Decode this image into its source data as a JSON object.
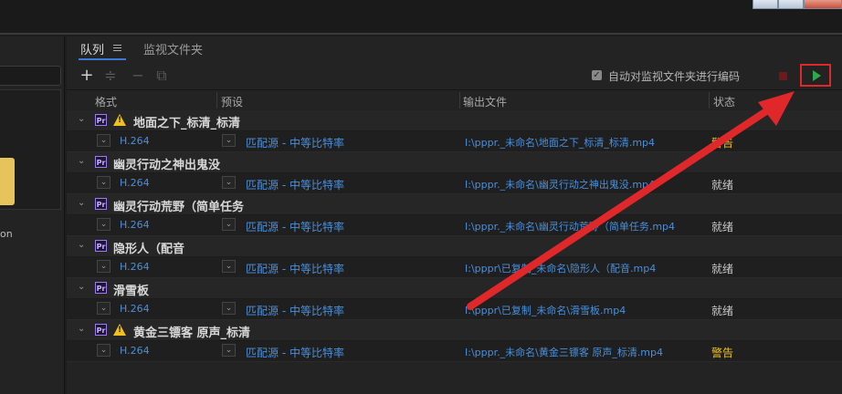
{
  "queue_panel": {
    "tabs": {
      "queue": "队列",
      "watch_folders": "监视文件夹"
    },
    "toolbar": {
      "add_icon": "plus-icon",
      "auto_encode_label": "自动对监视文件夹进行编码",
      "auto_encode_checked": true,
      "start_icon": "play-icon",
      "start_color": "#2fa84a",
      "highlight_color": "#e0282b"
    },
    "columns": {
      "format": "格式",
      "preset": "预设",
      "output": "输出文件",
      "status": "状态"
    },
    "jobs": [
      {
        "name": "地面之下_标清_标清",
        "warning": true,
        "format": "H.264",
        "preset": "匹配源 - 中等比特率",
        "output": "I:\\pppr._未命名\\地面之下_标清_标清.mp4",
        "status": "警告"
      },
      {
        "name": "幽灵行动之神出鬼没",
        "warning": false,
        "format": "H.264",
        "preset": "匹配源 - 中等比特率",
        "output": "I:\\pppr._未命名\\幽灵行动之神出鬼没.mp4",
        "status": "就绪"
      },
      {
        "name": "幽灵行动荒野（简单任务",
        "warning": false,
        "format": "H.264",
        "preset": "匹配源 - 中等比特率",
        "output": "I:\\pppr._未命名\\幽灵行动荒野（简单任务.mp4",
        "status": "就绪"
      },
      {
        "name": "隐形人（配音",
        "warning": false,
        "format": "H.264",
        "preset": "匹配源 - 中等比特率",
        "output": "I:\\pppr\\已复制_未命名\\隐形人（配音.mp4",
        "status": "就绪"
      },
      {
        "name": "滑雪板",
        "warning": false,
        "format": "H.264",
        "preset": "匹配源 - 中等比特率",
        "output": "I:\\pppr\\已复制_未命名\\滑雪板.mp4",
        "status": "就绪"
      },
      {
        "name": "黄金三镖客 原声_标清",
        "warning": true,
        "format": "H.264",
        "preset": "匹配源 - 中等比特率",
        "output": "I:\\pppr._未命名\\黄金三镖客 原声_标清.mp4",
        "status": "警告"
      }
    ]
  },
  "left_panel": {
    "item_label_fragment": "on"
  },
  "annotation": {
    "arrow_color": "#e0282b"
  }
}
